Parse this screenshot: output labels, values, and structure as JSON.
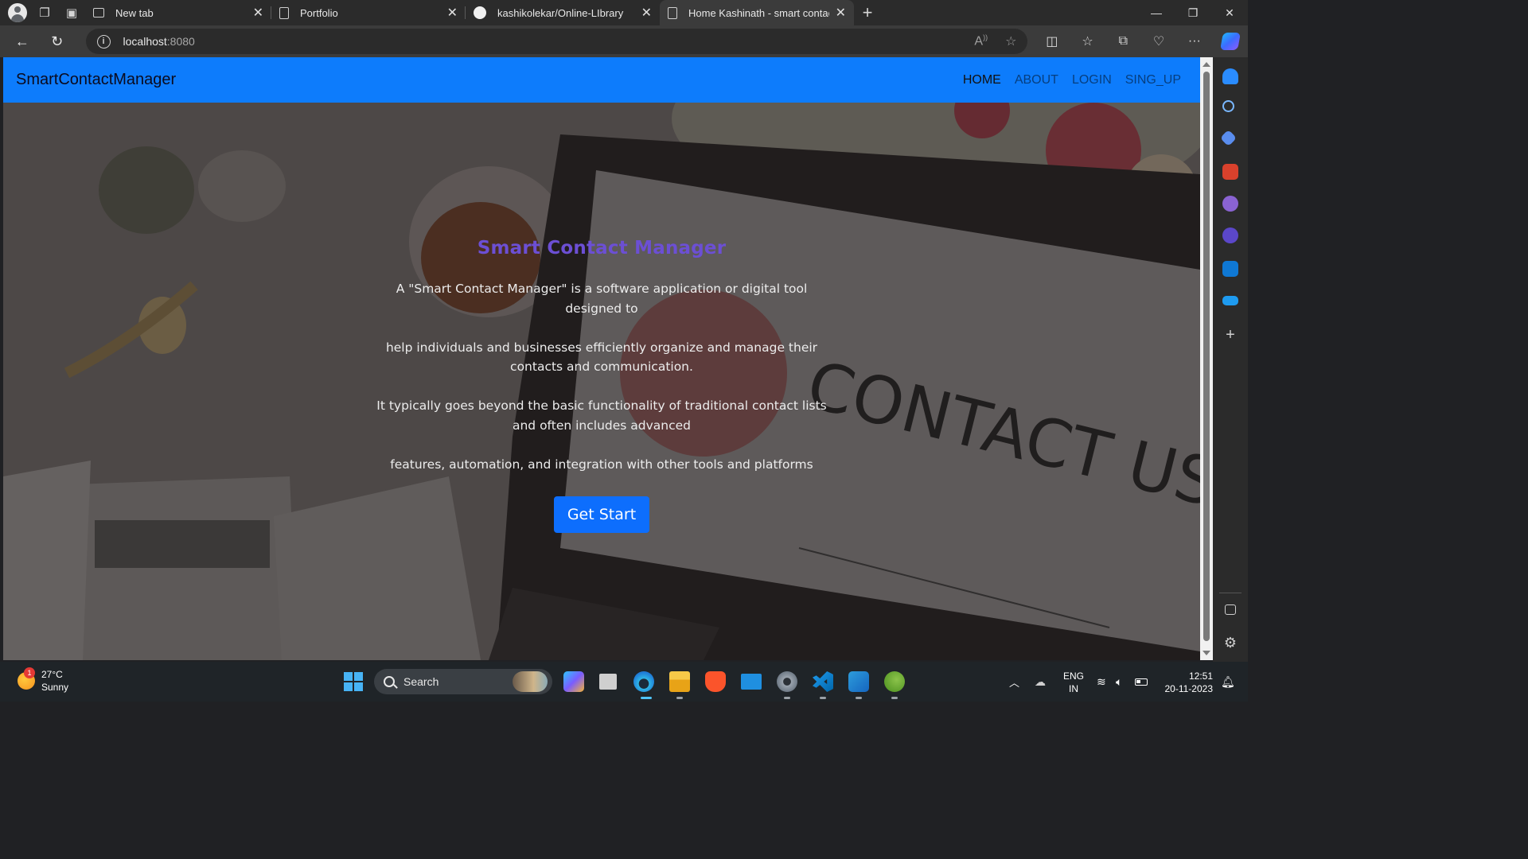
{
  "browser": {
    "tabs": [
      {
        "title": "New tab",
        "icon": "new-tab-page-icon",
        "active": false
      },
      {
        "title": "Portfolio",
        "icon": "document-icon",
        "active": false
      },
      {
        "title": "kashikolekar/Online-LIbrary",
        "icon": "github-icon",
        "active": false
      },
      {
        "title": "Home Kashinath - smart contact",
        "icon": "document-icon",
        "active": true
      }
    ],
    "address": {
      "host": "localhost",
      "port": ":8080"
    }
  },
  "site": {
    "brand": "SmartContactManager",
    "nav": [
      "HOME",
      "ABOUT",
      "LOGIN",
      "SING_UP"
    ],
    "active_nav": "HOME",
    "nav_color": "#0d7cfc",
    "hero": {
      "title": "Smart Contact Manager",
      "title_color": "#6c4fd4",
      "paragraphs": [
        "A \"Smart Contact Manager\" is a software application or digital tool designed to",
        "help individuals and businesses efficiently organize and manage their contacts and communication.",
        "It typically goes beyond the basic functionality of traditional contact lists and often includes advanced",
        "features, automation, and integration with other tools and platforms"
      ],
      "button": "Get Start"
    },
    "background_text": "CONTACT US"
  },
  "taskbar": {
    "weather": {
      "temp": "27°C",
      "condition": "Sunny",
      "badge": "1"
    },
    "search_placeholder": "Search",
    "lang": {
      "line1": "ENG",
      "line2": "IN"
    },
    "clock": {
      "time": "12:51",
      "date": "20-11-2023"
    },
    "apps": [
      "start-icon",
      "search",
      "copilot-pre-icon",
      "task-view-icon",
      "edge-icon",
      "file-explorer-icon",
      "brave-icon",
      "mail-icon",
      "settings-icon",
      "vscode-icon",
      "paint-icon",
      "spring-tool-suite-icon"
    ]
  }
}
